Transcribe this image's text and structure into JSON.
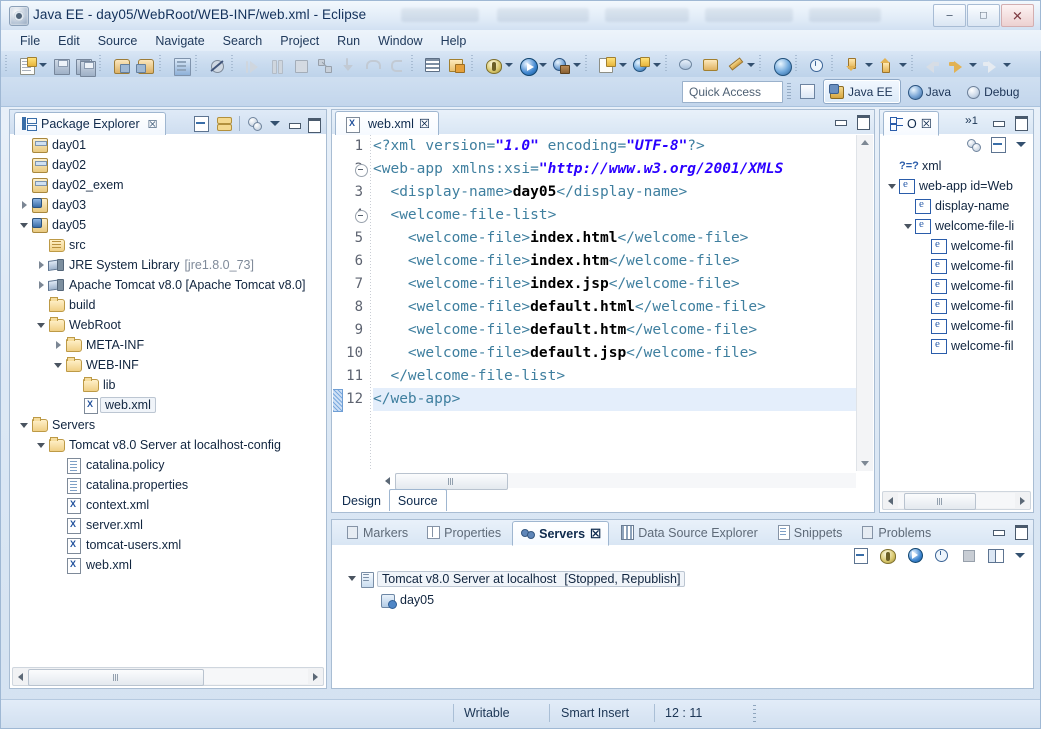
{
  "window": {
    "title": "Java EE - day05/WebRoot/WEB-INF/web.xml - Eclipse",
    "app_icon": "eclipse-icon",
    "minimize_label": "–",
    "maximize_label": "□",
    "close_label": "✕"
  },
  "menubar": {
    "items": [
      "File",
      "Edit",
      "Source",
      "Navigate",
      "Search",
      "Project",
      "Run",
      "Window",
      "Help"
    ]
  },
  "toolbar": {
    "groups": [
      {
        "items": [
          {
            "name": "new-wizard-icon",
            "glyph": "new",
            "dropdown": true
          },
          {
            "name": "save-icon",
            "glyph": "save"
          },
          {
            "name": "save-all-icon",
            "glyph": "saveall"
          }
        ]
      },
      {
        "items": [
          {
            "name": "export-icon",
            "glyph": "export"
          },
          {
            "name": "import-icon",
            "glyph": "import"
          }
        ]
      },
      {
        "items": [
          {
            "name": "console-icon",
            "glyph": "console"
          }
        ]
      },
      {
        "items": [
          {
            "name": "skip-breakpoints-icon",
            "glyph": "skipbp"
          }
        ]
      },
      {
        "items": [
          {
            "name": "resume-icon",
            "glyph": "resume"
          },
          {
            "name": "suspend-icon",
            "glyph": "suspend"
          },
          {
            "name": "terminate-icon",
            "glyph": "terminate"
          },
          {
            "name": "disconnect-icon",
            "glyph": "disconnect"
          },
          {
            "name": "step-into-icon",
            "glyph": "stepinto"
          },
          {
            "name": "step-over-icon",
            "glyph": "stepover"
          },
          {
            "name": "step-return-icon",
            "glyph": "stepreturn"
          }
        ]
      },
      {
        "items": [
          {
            "name": "open-task-icon",
            "glyph": "task"
          },
          {
            "name": "new-java-project-icon",
            "glyph": "jproject"
          }
        ]
      },
      {
        "items": [
          {
            "name": "debug-icon",
            "glyph": "debug",
            "dropdown": true
          },
          {
            "name": "run-icon",
            "glyph": "run",
            "dropdown": true
          },
          {
            "name": "run-external-tools-icon",
            "glyph": "exttools",
            "dropdown": true
          }
        ]
      },
      {
        "items": [
          {
            "name": "new-java-class-icon",
            "glyph": "newclass",
            "dropdown": true
          },
          {
            "name": "new-servlet-icon",
            "glyph": "newservlet",
            "dropdown": true
          }
        ]
      },
      {
        "items": [
          {
            "name": "search-icon",
            "glyph": "search"
          },
          {
            "name": "open-type-icon",
            "glyph": "opentype"
          },
          {
            "name": "annotation-icon",
            "glyph": "annotation",
            "dropdown": true
          }
        ]
      },
      {
        "items": [
          {
            "name": "open-web-browser-icon",
            "glyph": "globe"
          }
        ]
      },
      {
        "items": [
          {
            "name": "profile-icon",
            "glyph": "profile"
          }
        ]
      },
      {
        "items": [
          {
            "name": "previous-annotation-icon",
            "glyph": "prevann",
            "dropdown": true
          },
          {
            "name": "next-annotation-icon",
            "glyph": "nextann",
            "dropdown": true
          }
        ]
      },
      {
        "items": [
          {
            "name": "back-icon",
            "glyph": "back"
          },
          {
            "name": "forward-icon",
            "glyph": "forward",
            "dropdown": true
          },
          {
            "name": "pin-editor-icon",
            "glyph": "pin",
            "dropdown": true
          }
        ]
      }
    ]
  },
  "quick_access": {
    "placeholder": "Quick Access",
    "value": ""
  },
  "perspectives": {
    "open_perspective_tooltip": "Open Perspective",
    "items": [
      {
        "label": "Java EE",
        "icon": "javaee-perspective-icon",
        "active": true
      },
      {
        "label": "Java",
        "icon": "java-perspective-icon",
        "active": false
      },
      {
        "label": "Debug",
        "icon": "debug-perspective-icon",
        "active": false
      }
    ]
  },
  "package_explorer": {
    "tab_label": "Package Explorer",
    "tab_icon": "package-explorer-icon",
    "close_label": "☒",
    "toolbar_icons": [
      "collapse-all-icon",
      "link-with-editor-icon",
      "view-menu-icon",
      "minimize-icon",
      "maximize-icon"
    ],
    "tree": [
      {
        "indent": 0,
        "twist": "none",
        "icon": "project-icon",
        "label": "day01"
      },
      {
        "indent": 0,
        "twist": "none",
        "icon": "project-icon",
        "label": "day02"
      },
      {
        "indent": 0,
        "twist": "none",
        "icon": "project-icon",
        "label": "day02_exem"
      },
      {
        "indent": 0,
        "twist": "collapsed",
        "icon": "java-project-icon",
        "label": "day03"
      },
      {
        "indent": 0,
        "twist": "expanded",
        "icon": "java-project-icon",
        "label": "day05"
      },
      {
        "indent": 1,
        "twist": "none",
        "icon": "source-folder-icon",
        "label": "src"
      },
      {
        "indent": 1,
        "twist": "collapsed",
        "icon": "library-icon",
        "label": "JRE System Library",
        "suffix": "[jre1.8.0_73]"
      },
      {
        "indent": 1,
        "twist": "collapsed",
        "icon": "library-icon",
        "label": "Apache Tomcat v8.0 [Apache Tomcat v8.0]"
      },
      {
        "indent": 1,
        "twist": "none",
        "icon": "folder-icon",
        "label": "build"
      },
      {
        "indent": 1,
        "twist": "expanded",
        "icon": "folder-icon",
        "label": "WebRoot"
      },
      {
        "indent": 2,
        "twist": "collapsed",
        "icon": "folder-icon",
        "label": "META-INF"
      },
      {
        "indent": 2,
        "twist": "expanded",
        "icon": "folder-icon",
        "label": "WEB-INF"
      },
      {
        "indent": 3,
        "twist": "none",
        "icon": "folder-icon",
        "label": "lib"
      },
      {
        "indent": 3,
        "twist": "none",
        "icon": "xml-file-icon",
        "label": "web.xml",
        "selected": true
      },
      {
        "indent": 0,
        "twist": "expanded",
        "icon": "folder-icon",
        "label": "Servers"
      },
      {
        "indent": 1,
        "twist": "expanded",
        "icon": "folder-icon",
        "label": "Tomcat v8.0 Server at localhost-config"
      },
      {
        "indent": 2,
        "twist": "none",
        "icon": "text-file-icon",
        "label": "catalina.policy"
      },
      {
        "indent": 2,
        "twist": "none",
        "icon": "text-file-icon",
        "label": "catalina.properties"
      },
      {
        "indent": 2,
        "twist": "none",
        "icon": "xml-file-icon",
        "label": "context.xml"
      },
      {
        "indent": 2,
        "twist": "none",
        "icon": "xml-file-icon",
        "label": "server.xml"
      },
      {
        "indent": 2,
        "twist": "none",
        "icon": "xml-file-icon",
        "label": "tomcat-users.xml"
      },
      {
        "indent": 2,
        "twist": "none",
        "icon": "xml-file-icon",
        "label": "web.xml"
      }
    ]
  },
  "editor": {
    "tab_label": "web.xml",
    "tab_icon": "xml-file-icon",
    "close_label": "☒",
    "current_line": 12,
    "lines": [
      {
        "n": 1,
        "fold": false,
        "segments": [
          {
            "t": "<?xml version=",
            "c": "tag"
          },
          {
            "t": "\"1.0\"",
            "c": "attrvalue"
          },
          {
            "t": " encoding=",
            "c": "tag"
          },
          {
            "t": "\"UTF-8\"",
            "c": "attrvalue"
          },
          {
            "t": "?>",
            "c": "tag"
          }
        ]
      },
      {
        "n": 2,
        "fold": true,
        "segments": [
          {
            "t": "<web-app ",
            "c": "tag"
          },
          {
            "t": "xmlns:xsi=",
            "c": "tag"
          },
          {
            "t": "\"http://www.w3.org/2001/XMLS",
            "c": "attrvalue"
          }
        ]
      },
      {
        "n": 3,
        "fold": false,
        "segments": [
          {
            "t": "  <display-name>",
            "c": "tag"
          },
          {
            "t": "day05",
            "c": "text"
          },
          {
            "t": "</display-name>",
            "c": "tag"
          }
        ]
      },
      {
        "n": 4,
        "fold": true,
        "segments": [
          {
            "t": "  <welcome-file-list>",
            "c": "tag"
          }
        ]
      },
      {
        "n": 5,
        "fold": false,
        "segments": [
          {
            "t": "    <welcome-file>",
            "c": "tag"
          },
          {
            "t": "index.html",
            "c": "text"
          },
          {
            "t": "</welcome-file>",
            "c": "tag"
          }
        ]
      },
      {
        "n": 6,
        "fold": false,
        "segments": [
          {
            "t": "    <welcome-file>",
            "c": "tag"
          },
          {
            "t": "index.htm",
            "c": "text"
          },
          {
            "t": "</welcome-file>",
            "c": "tag"
          }
        ]
      },
      {
        "n": 7,
        "fold": false,
        "segments": [
          {
            "t": "    <welcome-file>",
            "c": "tag"
          },
          {
            "t": "index.jsp",
            "c": "text"
          },
          {
            "t": "</welcome-file>",
            "c": "tag"
          }
        ]
      },
      {
        "n": 8,
        "fold": false,
        "segments": [
          {
            "t": "    <welcome-file>",
            "c": "tag"
          },
          {
            "t": "default.html",
            "c": "text"
          },
          {
            "t": "</welcome-file>",
            "c": "tag"
          }
        ]
      },
      {
        "n": 9,
        "fold": false,
        "segments": [
          {
            "t": "    <welcome-file>",
            "c": "tag"
          },
          {
            "t": "default.htm",
            "c": "text"
          },
          {
            "t": "</welcome-file>",
            "c": "tag"
          }
        ]
      },
      {
        "n": 10,
        "fold": false,
        "segments": [
          {
            "t": "    <welcome-file>",
            "c": "tag"
          },
          {
            "t": "default.jsp",
            "c": "text"
          },
          {
            "t": "</welcome-file>",
            "c": "tag"
          }
        ]
      },
      {
        "n": 11,
        "fold": false,
        "segments": [
          {
            "t": "  </welcome-file-list>",
            "c": "tag"
          }
        ]
      },
      {
        "n": 12,
        "fold": false,
        "current": true,
        "segments": [
          {
            "t": "</web-app>",
            "c": "tag"
          }
        ]
      }
    ],
    "page_tabs": [
      {
        "label": "Design",
        "active": false
      },
      {
        "label": "Source",
        "active": true
      }
    ]
  },
  "outline": {
    "tab_icon": "outline-icon",
    "tab_label": "O",
    "close_label": "☒",
    "overflow_label": "1",
    "toolbar_icons": [
      "sort-icon",
      "collapse-all-icon",
      "view-menu-icon"
    ],
    "tree": [
      {
        "indent": 0,
        "twist": "none",
        "icon": "processing-instruction-icon",
        "label": "xml"
      },
      {
        "indent": 0,
        "twist": "expanded",
        "icon": "element-icon",
        "label": "web-app id=Web"
      },
      {
        "indent": 1,
        "twist": "none",
        "icon": "element-icon",
        "label": "display-name"
      },
      {
        "indent": 1,
        "twist": "expanded",
        "icon": "element-icon",
        "label": "welcome-file-li"
      },
      {
        "indent": 2,
        "twist": "none",
        "icon": "element-icon",
        "label": "welcome-fil"
      },
      {
        "indent": 2,
        "twist": "none",
        "icon": "element-icon",
        "label": "welcome-fil"
      },
      {
        "indent": 2,
        "twist": "none",
        "icon": "element-icon",
        "label": "welcome-fil"
      },
      {
        "indent": 2,
        "twist": "none",
        "icon": "element-icon",
        "label": "welcome-fil"
      },
      {
        "indent": 2,
        "twist": "none",
        "icon": "element-icon",
        "label": "welcome-fil"
      },
      {
        "indent": 2,
        "twist": "none",
        "icon": "element-icon",
        "label": "welcome-fil"
      }
    ]
  },
  "bottom_panel": {
    "tabs": [
      {
        "label": "Markers",
        "icon": "markers-icon",
        "active": false
      },
      {
        "label": "Properties",
        "icon": "properties-icon",
        "active": false
      },
      {
        "label": "Servers",
        "icon": "servers-icon",
        "active": true,
        "close_label": "☒"
      },
      {
        "label": "Data Source Explorer",
        "icon": "datasource-icon",
        "active": false
      },
      {
        "label": "Snippets",
        "icon": "snippets-icon",
        "active": false
      },
      {
        "label": "Problems",
        "icon": "problems-icon",
        "active": false
      }
    ],
    "toolbar_icons": [
      "new-server-icon",
      "debug-server-icon",
      "start-server-icon",
      "profile-server-icon",
      "stop-server-icon",
      "publish-icon",
      "view-menu-icon"
    ],
    "tree": [
      {
        "indent": 0,
        "twist": "expanded",
        "icon": "server-icon",
        "label": "Tomcat v8.0 Server at localhost",
        "status": "[Stopped, Republish]",
        "selected": true
      },
      {
        "indent": 1,
        "twist": "none",
        "icon": "module-icon",
        "label": "day05"
      }
    ]
  },
  "statusbar": {
    "writable": "Writable",
    "insert_mode": "Smart Insert",
    "cursor_position": "12 : 11"
  },
  "colors": {
    "tag": "#3f7f7f",
    "attribute_value": "#2a00ff",
    "text_content": "#000000",
    "current_line_highlight": "#e4eefb",
    "selection": "#f0f4f9",
    "chrome": "#c3d6ec"
  }
}
